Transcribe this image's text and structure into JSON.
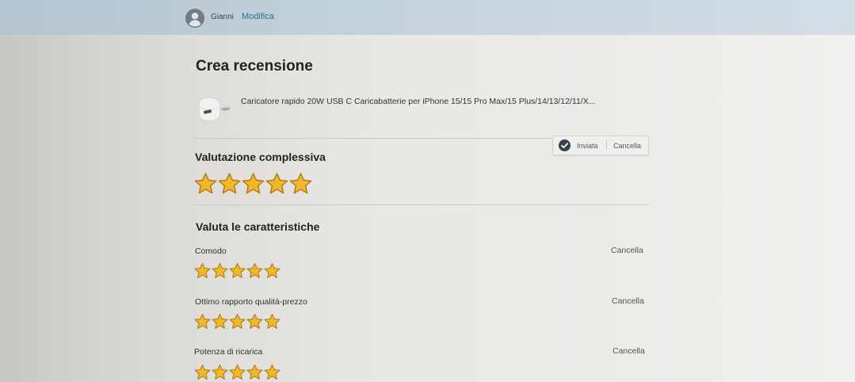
{
  "header": {
    "username": "Gianni",
    "edit_label": "Modifica"
  },
  "page": {
    "title": "Crea recensione"
  },
  "product": {
    "title": "Caricatore rapido 20W USB C Caricabatterie per iPhone 15/15 Pro Max/15 Plus/14/13/12/11/X..."
  },
  "overall": {
    "heading": "Valutazione complessiva",
    "rating": 5,
    "max_rating": 5,
    "status_label": "Inviata",
    "cancel_label": "Cancella"
  },
  "features": {
    "heading": "Valuta le caratteristiche",
    "items": [
      {
        "label": "Comodo",
        "rating": 5,
        "cancel_label": "Cancella"
      },
      {
        "label": "Ottimo rapporto qualità-prezzo",
        "rating": 5,
        "cancel_label": "Cancella"
      },
      {
        "label": "Potenza di ricarica",
        "rating": 5,
        "cancel_label": "Cancella"
      }
    ]
  },
  "colors": {
    "star_fill": "#f3b72a",
    "star_stroke": "#b0791a",
    "check_icon": "#33414a",
    "link": "#2a6f8a"
  },
  "icons": [
    "user-avatar-icon",
    "check-circle-icon",
    "star-icon"
  ]
}
